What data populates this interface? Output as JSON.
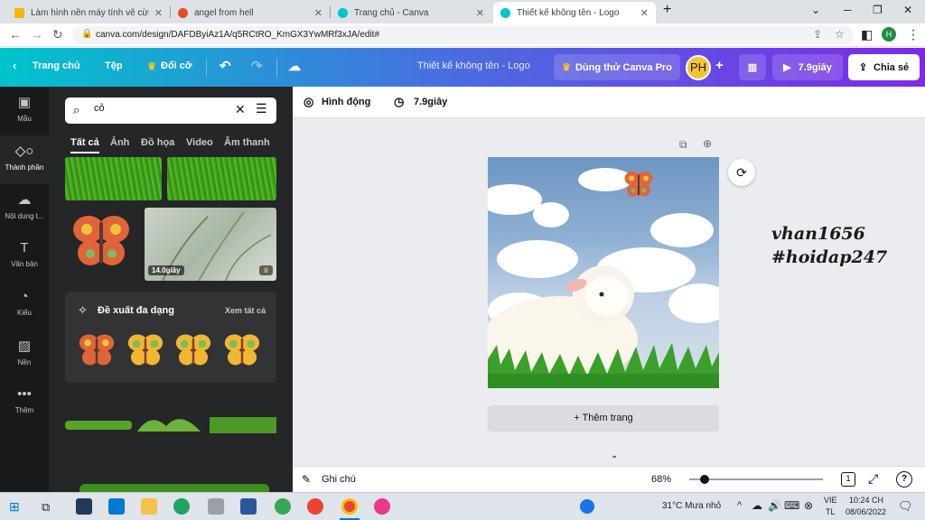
{
  "browser": {
    "tabs": [
      {
        "title": "Làm hình nền máy tính vẽ cừu N",
        "color": "#f2b705"
      },
      {
        "title": "angel from hell",
        "color": "#e34c26"
      },
      {
        "title": "Trang chủ - Canva",
        "color": "#00c4cc"
      },
      {
        "title": "Thiết kế không tên - Logo",
        "color": "#00c4cc"
      }
    ],
    "url": "canva.com/design/DAFDByiAz1A/q5RCtRO_KmGX3YwMRf3xJA/edit#",
    "profile_initial": "H"
  },
  "header": {
    "home": "Trang chủ",
    "file": "Tệp",
    "resize": "Đổi cỡ",
    "doc_title": "Thiết kế không tên - Logo",
    "try_pro": "Dùng thử Canva Pro",
    "user_initials": "PH",
    "play_duration": "7.9giây",
    "share": "Chia sẻ"
  },
  "rail": [
    {
      "icon": "template-icon",
      "label": "Mẫu"
    },
    {
      "icon": "elements-icon",
      "label": "Thành phần"
    },
    {
      "icon": "upload-icon",
      "label": "Nội dung t..."
    },
    {
      "icon": "text-icon",
      "label": "Văn bản"
    },
    {
      "icon": "style-icon",
      "label": "Kiểu"
    },
    {
      "icon": "background-icon",
      "label": "Nền"
    },
    {
      "icon": "more-icon",
      "label": "Thêm"
    }
  ],
  "panel": {
    "search_value": "cỏ",
    "tabs": [
      "Tất cả",
      "Ảnh",
      "Đồ họa",
      "Video",
      "Âm thanh"
    ],
    "video_duration": "14.0giây",
    "suggest_title": "Đề xuất đa dạng",
    "see_all": "Xem tất cả"
  },
  "editor": {
    "animate": "Hình động",
    "duration": "7.9giây",
    "add_page": "+ Thêm trang",
    "overlay_line1": "vhan1656",
    "overlay_line2": "#hoidap247"
  },
  "bottom": {
    "notes": "Ghi chú",
    "zoom": "68%",
    "zoom_fraction": 0.03,
    "page_count": "1"
  },
  "taskbar": {
    "weather": "31°C  Mưa nhỏ",
    "lang1": "VIE",
    "lang2": "TL",
    "time": "10:24 CH",
    "date": "08/06/2022"
  },
  "colors": {
    "header_left": "#00c4cc",
    "header_right": "#7d2ae8",
    "panel_bg": "#252627",
    "rail_bg": "#18191b",
    "share_bg": "#ffffff",
    "crown": "#f4c430"
  }
}
